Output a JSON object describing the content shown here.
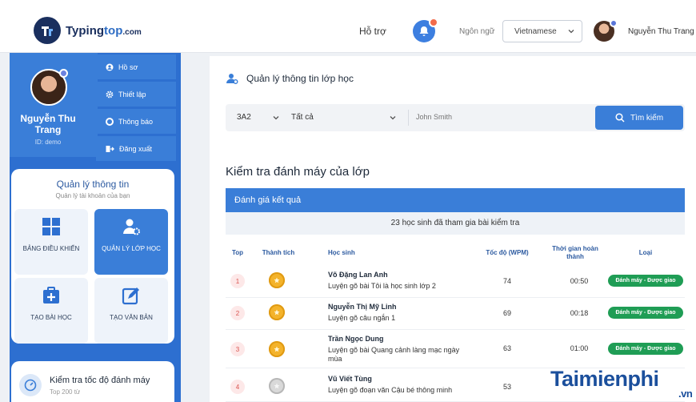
{
  "header": {
    "logo_typing": "Typing",
    "logo_top": "top",
    "logo_com": ".com",
    "support": "Hỗ trợ",
    "language_label": "Ngôn ngữ",
    "language_value": "Vietnamese",
    "user_name": "Nguyễn Thu Trang"
  },
  "sidebar": {
    "profile_name": "Nguyễn Thu Trang",
    "profile_id": "ID: demo",
    "menu": [
      {
        "label": "Hồ sơ",
        "icon": "user-icon"
      },
      {
        "label": "Thiết lập",
        "icon": "gear-icon"
      },
      {
        "label": "Thông báo",
        "icon": "notification-icon"
      },
      {
        "label": "Đăng xuất",
        "icon": "logout-icon"
      }
    ],
    "card_title": "Quản lý thông tin",
    "card_sub": "Quản lý tài khoản của bạn",
    "tiles": [
      {
        "label": "BẢNG ĐIỀU KHIỂN",
        "icon": "dashboard-icon"
      },
      {
        "label": "QUẢN LÝ LỚP HỌC",
        "icon": "class-manage-icon"
      },
      {
        "label": "TẠO BÀI HỌC",
        "icon": "create-lesson-icon"
      },
      {
        "label": "TẠO VĂN BẢN",
        "icon": "create-text-icon"
      }
    ],
    "speed_title": "Kiểm tra tốc độ đánh máy",
    "speed_sub": "Top 200 từ"
  },
  "main": {
    "title": "Quản lý thông tin lớp học",
    "class_value": "3A2",
    "filter_value": "Tất cả",
    "search_placeholder": "John Smith",
    "search_button": "Tìm kiếm",
    "section_title": "Kiểm tra đánh máy của lớp",
    "result_header": "Đánh giá kết quả",
    "participants": "23 học sinh đã tham gia bài kiểm tra",
    "columns": {
      "top": "Top",
      "achievement": "Thành tích",
      "student": "Học sinh",
      "speed": "Tốc độ (WPM)",
      "time": "Thời gian hoàn thành",
      "type": "Loại"
    },
    "rows": [
      {
        "rank": "1",
        "medal": "gold",
        "name": "Võ Đặng Lan Anh",
        "lesson": "Luyện gõ bài Tôi là học sinh lớp 2",
        "speed": "74",
        "time": "00:50",
        "type": "Đánh máy - Được giao"
      },
      {
        "rank": "2",
        "medal": "gold",
        "name": "Nguyễn Thị Mỹ Linh",
        "lesson": "Luyện gõ câu ngắn 1",
        "speed": "69",
        "time": "00:18",
        "type": "Đánh máy - Được giao"
      },
      {
        "rank": "3",
        "medal": "gold",
        "name": "Trần Ngọc Dung",
        "lesson": "Luyện gõ bài Quang cảnh làng mạc ngày mùa",
        "speed": "63",
        "time": "01:00",
        "type": "Đánh máy - Được giao"
      },
      {
        "rank": "4",
        "medal": "silver",
        "name": "Vũ Viết Tùng",
        "lesson": "Luyện gõ đoạn văn Cậu bé thông minh",
        "speed": "53",
        "time": "",
        "type": ""
      }
    ]
  },
  "watermark": {
    "text": "Taimienphi",
    "suffix": ".vn"
  },
  "colors": {
    "primary": "#3a7ed8",
    "sidebar": "#2d6fd0",
    "badge_green": "#1f9d55",
    "gold": "#f4b32b"
  }
}
